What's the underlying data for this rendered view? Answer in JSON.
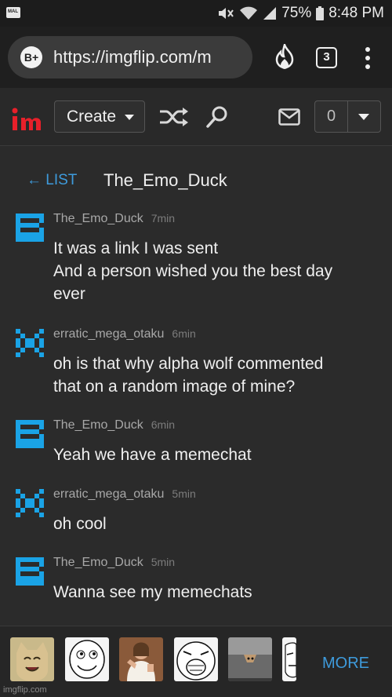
{
  "status_bar": {
    "app_badge": "MAL",
    "battery": "75%",
    "time": "8:48 PM",
    "icons": [
      "mute-icon",
      "wifi-icon",
      "signal-icon",
      "battery-icon"
    ]
  },
  "browser": {
    "badge": "B+",
    "url": "https://imgflip.com/m",
    "tab_count": "3",
    "icons": [
      "fire-icon",
      "tabs-icon",
      "kebab-menu-icon"
    ]
  },
  "site_nav": {
    "logo": "im",
    "create_label": "Create",
    "notification_count": "0",
    "icons": [
      "shuffle-icon",
      "search-icon",
      "mail-icon",
      "chevron-down-icon"
    ]
  },
  "chat": {
    "back_label": "← LIST",
    "title": "The_Emo_Duck"
  },
  "messages": [
    {
      "user": "The_Emo_Duck",
      "time": "7min",
      "lines": [
        "It was a link I was sent",
        "And a person wished you the best day",
        "ever"
      ],
      "avatar": "pixel-avatar-duck"
    },
    {
      "user": "erratic_mega_otaku",
      "time": "6min",
      "lines": [
        "oh is that why alpha wolf commented",
        "that on a random image of mine?"
      ],
      "avatar": "pixel-avatar-otaku"
    },
    {
      "user": "The_Emo_Duck",
      "time": "6min",
      "lines": [
        "Yeah we have a memechat"
      ],
      "avatar": "pixel-avatar-duck"
    },
    {
      "user": "erratic_mega_otaku",
      "time": "5min",
      "lines": [
        "oh cool"
      ],
      "avatar": "pixel-avatar-otaku"
    },
    {
      "user": "The_Emo_Duck",
      "time": "5min",
      "lines": [
        "Wanna see my memechats"
      ],
      "avatar": "pixel-avatar-duck"
    }
  ],
  "meme_strip": {
    "thumbnails": [
      "happy-cat-thumb",
      "rage-face-thumb",
      "buddy-christ-thumb",
      "lol-face-thumb",
      "ceiling-cat-thumb",
      "troll-face-thumb"
    ],
    "more_label": "MORE",
    "watermark": "imgflip.com"
  },
  "colors": {
    "accent_blue": "#3e9bdc",
    "avatar_blue": "#1aa3e6",
    "logo_red": "#e8202a",
    "background": "#2b2b2b"
  }
}
